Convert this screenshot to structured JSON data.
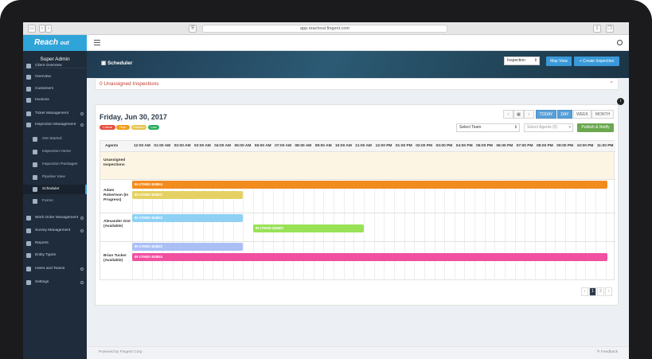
{
  "browser": {
    "url": "app.reachout.fingent.com"
  },
  "brand": {
    "name": "Reach",
    "tagline": "out",
    "accent": "#2fa4d8"
  },
  "sidebar": {
    "user": "Super Admin",
    "items": [
      {
        "label": "Client Overview",
        "level": 0
      },
      {
        "label": "Overview",
        "level": 0
      },
      {
        "label": "Customers",
        "level": 0
      },
      {
        "label": "Invoices",
        "level": 0
      },
      {
        "label": "Ticket Management",
        "level": 0
      },
      {
        "label": "Inspection Management",
        "level": 0
      },
      {
        "label": "Get Started",
        "level": 1
      },
      {
        "label": "Inspection Home",
        "level": 1
      },
      {
        "label": "Inspection Packages",
        "level": 1
      },
      {
        "label": "Pipeline View",
        "level": 1
      },
      {
        "label": "Scheduler",
        "level": 1
      },
      {
        "label": "Forms",
        "level": 1
      },
      {
        "label": "Work Order Management",
        "level": 0
      },
      {
        "label": "Survey Management",
        "level": 0
      },
      {
        "label": "Reports",
        "level": 0
      },
      {
        "label": "Entity Types",
        "level": 0
      },
      {
        "label": "Users and Teams",
        "level": 0
      },
      {
        "label": "Settings",
        "level": 0
      }
    ]
  },
  "banner": {
    "title": "Scheduler",
    "select": "Inspection",
    "map_view": "Map View",
    "create": "+ Create Inspection"
  },
  "unassigned": {
    "text": "0 Unassigned Inspections"
  },
  "scheduler": {
    "date": "Friday, Jun 30, 2017",
    "legend": [
      {
        "label": "Critical",
        "color": "#e74c3c"
      },
      {
        "label": "High",
        "color": "#f39c12"
      },
      {
        "label": "Medium",
        "color": "#e6c34a"
      },
      {
        "label": "Low",
        "color": "#27ae60"
      }
    ],
    "nav": {
      "prev": "‹",
      "cal": "▦",
      "next": "›",
      "today": "TODAY",
      "day": "DAY",
      "week": "WEEK",
      "month": "MONTH"
    },
    "select_team": "Select Team",
    "select_agents": "Select Agents (0)",
    "publish": "Publish & Notify",
    "agents_header": "Agents",
    "hours": [
      "12:00 AM",
      "01:00 AM",
      "02:00 AM",
      "03:00 AM",
      "04:00 AM",
      "05:00 AM",
      "06:00 AM",
      "07:00 AM",
      "08:00 AM",
      "09:00 AM",
      "10:00 AM",
      "11:00 AM",
      "12:00 PM",
      "01:00 PM",
      "02:00 PM",
      "03:00 PM",
      "04:00 PM",
      "05:00 PM",
      "06:00 PM",
      "07:00 PM",
      "08:00 PM",
      "09:00 PM",
      "10:00 PM",
      "11:00 PM"
    ],
    "rows": [
      {
        "agent": "Unassigned Inspections"
      },
      {
        "agent": "Adam Robertson (In Progress)"
      },
      {
        "agent": "Alexander Gist (Available)"
      },
      {
        "agent": "Brian Tucker (Available)"
      }
    ],
    "events": [
      {
        "label": "IN-170620-193844",
        "color": "#f28b1e",
        "row": 1,
        "start": 0,
        "end": 23.6
      },
      {
        "label": "IN-170620-184822",
        "color": "#e5d163",
        "row": 1,
        "start": 0,
        "end": 5.5
      },
      {
        "label": "IN-170620-184822",
        "color": "#8fd1f5",
        "row": 2,
        "start": 0,
        "end": 5.5
      },
      {
        "label": "IN-170620-184822",
        "color": "#99e256",
        "row": 2,
        "start": 6,
        "end": 11.5
      },
      {
        "label": "IN-170620-184822",
        "color": "#a9bff5",
        "row": 3,
        "start": 0,
        "end": 5.5
      },
      {
        "label": "IN-170620-193844",
        "color": "#f14fa0",
        "row": 3,
        "start": 0,
        "end": 23.6
      }
    ],
    "pages": [
      "‹",
      "1",
      "2",
      "›"
    ]
  },
  "footer": {
    "left": "Powered by Fingent Corp",
    "right": "Feedback"
  }
}
